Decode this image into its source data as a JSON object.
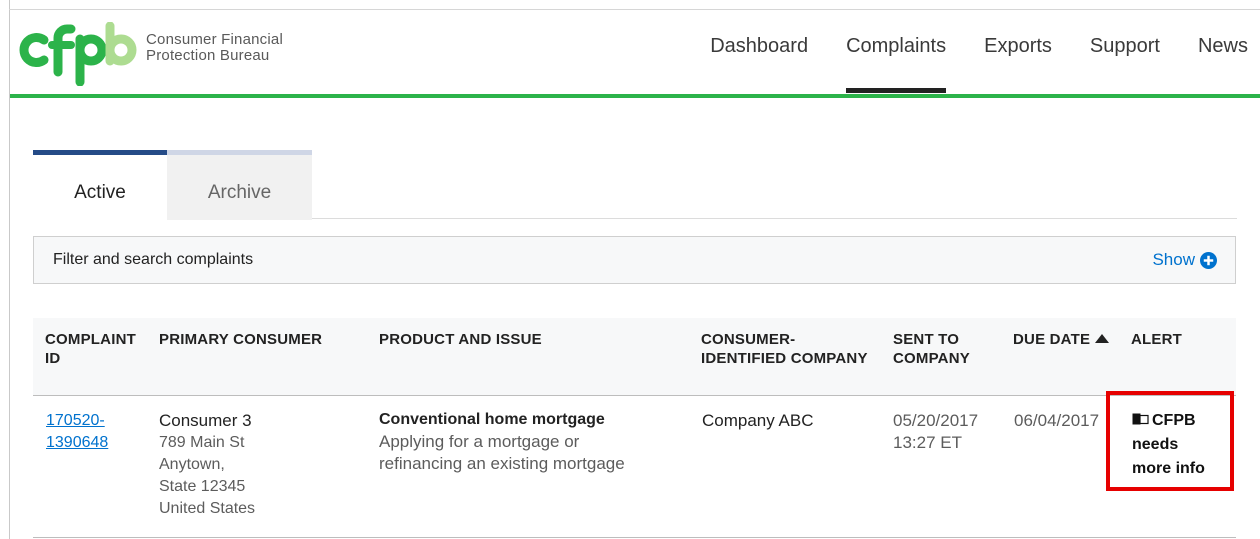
{
  "app": {
    "logo_text": "cfpb",
    "org_name_line1": "Consumer Financial",
    "org_name_line2": "Protection Bureau",
    "brand_green": "#2cb34a",
    "brand_light_green": "#addc91"
  },
  "nav": {
    "items": [
      {
        "label": "Dashboard"
      },
      {
        "label": "Complaints",
        "active": true
      },
      {
        "label": "Exports"
      },
      {
        "label": "Support"
      },
      {
        "label": "News"
      }
    ]
  },
  "tabs": [
    {
      "label": "Active",
      "active": true
    },
    {
      "label": "Archive"
    }
  ],
  "filter": {
    "label": "Filter and search complaints",
    "toggle_label": "Show",
    "toggle_icon": "plus-circle-icon"
  },
  "table": {
    "columns": {
      "complaint_id_1": "COMPLAINT",
      "complaint_id_2": "ID",
      "primary_consumer": "PRIMARY CONSUMER",
      "product_issue": "PRODUCT AND ISSUE",
      "company_1": "CONSUMER-",
      "company_2": "IDENTIFIED COMPANY",
      "sent_1": "SENT TO",
      "sent_2": "COMPANY",
      "due_date": "DUE DATE",
      "due_date_sort": "ascending",
      "alert": "ALERT"
    },
    "rows": [
      {
        "complaint_id_1": "170520-",
        "complaint_id_2": "1390648",
        "consumer_name": "Consumer 3",
        "address_1": "789 Main St",
        "address_2": "Anytown,",
        "address_3": "State 12345",
        "address_4": "United States",
        "product": "Conventional home mortgage",
        "issue_1": "Applying for a mortgage or",
        "issue_2": "refinancing an existing mortgage",
        "company": "Company ABC",
        "sent_date": "05/20/2017",
        "sent_time": "13:27 ET",
        "due_date": "06/04/2017",
        "alert_1": "CFPB",
        "alert_2": "needs",
        "alert_3": "more info",
        "alert_icon": "flag-icon",
        "alert_highlight_color": "#e60000"
      }
    ]
  }
}
